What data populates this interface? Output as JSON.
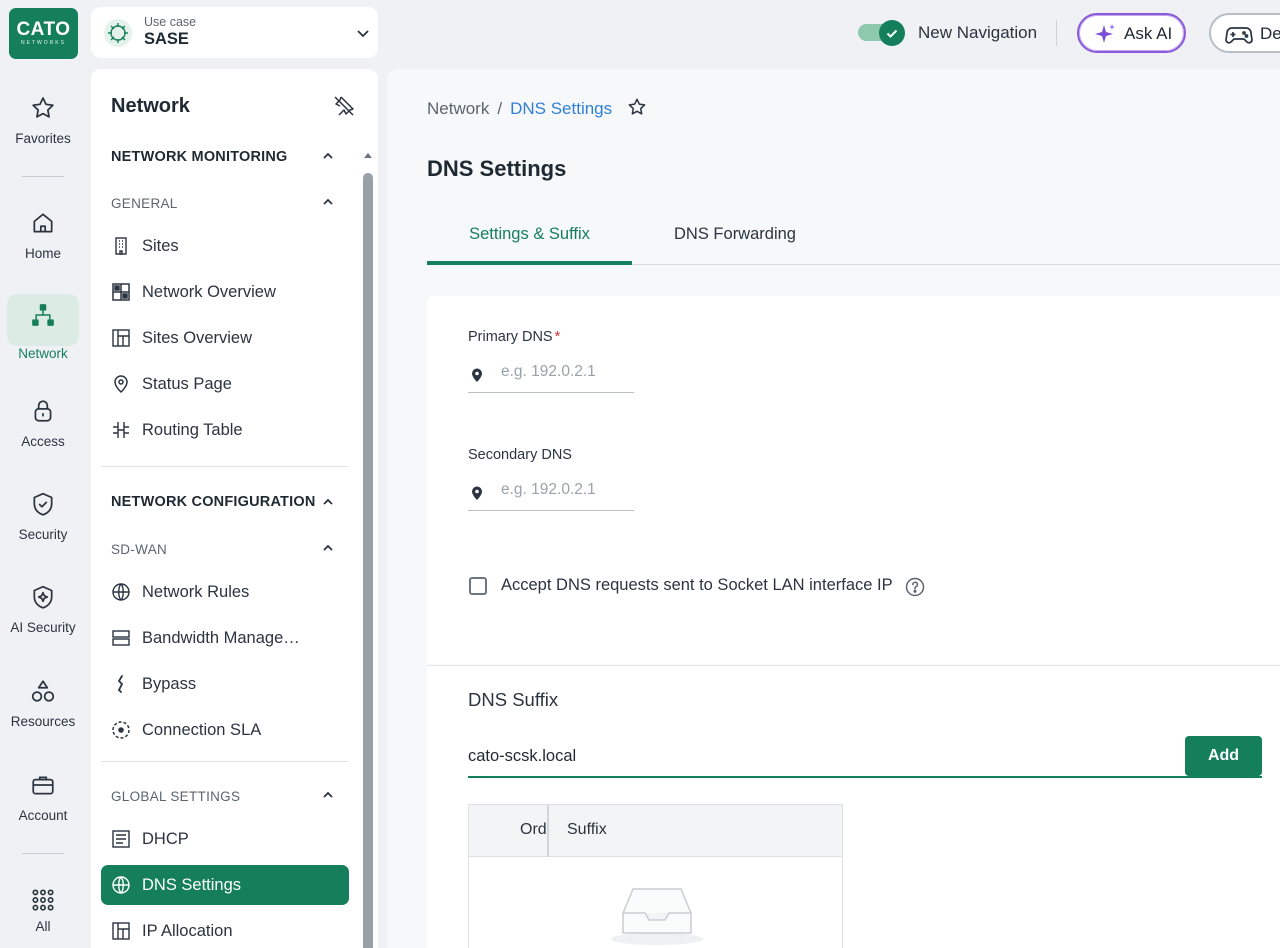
{
  "logo": {
    "text": "CATO",
    "subtext": "NETWORKS"
  },
  "rail": {
    "favorites": "Favorites",
    "home": "Home",
    "network": "Network",
    "access": "Access",
    "security": "Security",
    "ai_security": "AI Security",
    "resources": "Resources",
    "account": "Account",
    "all": "All"
  },
  "usecase": {
    "label": "Use case",
    "value": "SASE"
  },
  "topbar": {
    "new_navigation": "New Navigation",
    "new_navigation_enabled": true,
    "ask_ai": "Ask AI",
    "demo": "De"
  },
  "subnav": {
    "title": "Network",
    "sections": {
      "monitoring": "NETWORK MONITORING",
      "general": "GENERAL",
      "configuration": "NETWORK CONFIGURATION",
      "sdwan": "SD-WAN",
      "global": "GLOBAL SETTINGS"
    },
    "items": {
      "sites": "Sites",
      "network_overview": "Network Overview",
      "sites_overview": "Sites Overview",
      "status_page": "Status Page",
      "routing_table": "Routing Table",
      "network_rules": "Network Rules",
      "bandwidth": "Bandwidth Manage…",
      "bypass": "Bypass",
      "connection_sla": "Connection SLA",
      "dhcp": "DHCP",
      "dns_settings": "DNS Settings",
      "ip_allocation": "IP Allocation"
    }
  },
  "breadcrumb": {
    "parent": "Network",
    "separator": "/",
    "current": "DNS Settings"
  },
  "page": {
    "title": "DNS Settings",
    "tabs": [
      "Settings & Suffix",
      "DNS Forwarding"
    ],
    "active_tab": 0
  },
  "form": {
    "primary_label": "Primary DNS",
    "primary_required": "*",
    "primary_placeholder": "e.g. 192.0.2.1",
    "primary_value": "",
    "secondary_label": "Secondary DNS",
    "secondary_placeholder": "e.g. 192.0.2.1",
    "secondary_value": "",
    "accept_label": "Accept DNS requests sent to Socket LAN interface IP",
    "accept_checked": false
  },
  "suffix": {
    "title": "DNS Suffix",
    "input_value": "cato-scsk.local",
    "add_label": "Add",
    "columns": [
      "Ord",
      "Suffix"
    ]
  },
  "colors": {
    "brand": "#157f5b",
    "link": "#2f7fd8",
    "required": "#d93131"
  }
}
